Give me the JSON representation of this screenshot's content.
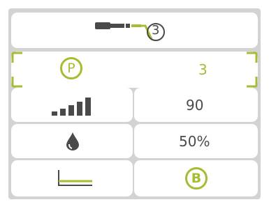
{
  "colors": {
    "accent": "#a4bd32",
    "dark": "#4a4a4a",
    "panel": "#d3d3d3"
  },
  "header": {
    "icon": "handpiece-icon",
    "instrument_number": "3"
  },
  "program": {
    "icon": "p-circle-icon",
    "label": "P",
    "value": "3"
  },
  "power": {
    "icon": "power-bars-icon",
    "value": "90"
  },
  "water": {
    "icon": "water-drop-icon",
    "value": "50%"
  },
  "mode": {
    "icon": "baseline-mode-icon",
    "label": "B"
  }
}
